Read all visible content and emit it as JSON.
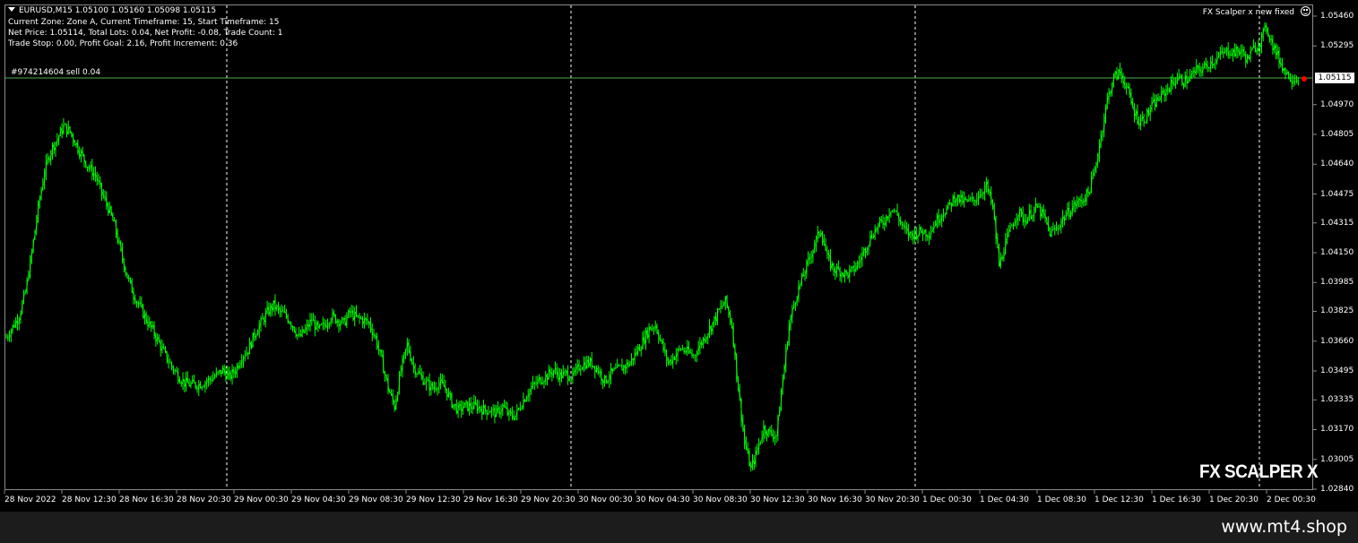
{
  "chart_header": {
    "symbol_line": "EURUSD,M15  1.05100 1.05160 1.05098 1.05115",
    "line2": "Current Zone: Zone A, Current Timeframe: 15, Start Timeframe: 15",
    "line3": "Net Price: 1.05114, Total Lots: 0.04, Net Profit: -0.08, Trade Count: 1",
    "line4": "Trade Stop: 0.00, Profit Goal: 2.16, Profit Increment: 0.36"
  },
  "expert": {
    "name": "FX Scalper x new fixed",
    "icon": "smiley-icon",
    "brand": "FX SCALPER X"
  },
  "order": {
    "label": "#974214604 sell 0.04",
    "price_tag": "1.05115",
    "line_color": "#4caf50"
  },
  "footer": {
    "site": "www.mt4.shop"
  },
  "colors": {
    "background": "#000000",
    "candles": "#00ff00",
    "grid_separator": "#ffffff",
    "text": "#ffffff"
  },
  "chart_data": {
    "type": "line",
    "symbol": "EURUSD",
    "timeframe": "M15",
    "ylim": [
      1.0284,
      1.0546
    ],
    "y_ticks": [
      "1.05460",
      "1.05295",
      "1.05115",
      "1.04970",
      "1.04805",
      "1.04640",
      "1.04475",
      "1.04315",
      "1.04150",
      "1.03985",
      "1.03825",
      "1.03660",
      "1.03495",
      "1.03335",
      "1.03170",
      "1.03005",
      "1.02840"
    ],
    "x_ticks": [
      "28 Nov 2022",
      "28 Nov 12:30",
      "28 Nov 16:30",
      "28 Nov 20:30",
      "29 Nov 00:30",
      "29 Nov 04:30",
      "29 Nov 08:30",
      "29 Nov 12:30",
      "29 Nov 16:30",
      "29 Nov 20:30",
      "30 Nov 00:30",
      "30 Nov 04:30",
      "30 Nov 08:30",
      "30 Nov 12:30",
      "30 Nov 16:30",
      "30 Nov 20:30",
      "1 Dec 00:30",
      "1 Dec 04:30",
      "1 Dec 08:30",
      "1 Dec 12:30",
      "1 Dec 16:30",
      "1 Dec 20:30",
      "2 Dec 00:30"
    ],
    "day_separators": [
      "29 Nov 00:00",
      "30 Nov 00:00",
      "1 Dec 00:00",
      "2 Dec 00:00"
    ],
    "current_price": 1.05115,
    "price_path": [
      [
        0,
        1.0368
      ],
      [
        2,
        1.038
      ],
      [
        3,
        1.0393
      ],
      [
        4,
        1.0415
      ],
      [
        5,
        1.044
      ],
      [
        6,
        1.046
      ],
      [
        7,
        1.0472
      ],
      [
        8,
        1.0478
      ],
      [
        9,
        1.0485
      ],
      [
        10,
        1.0482
      ],
      [
        11,
        1.0475
      ],
      [
        12,
        1.0468
      ],
      [
        13,
        1.0462
      ],
      [
        14,
        1.0458
      ],
      [
        15,
        1.0448
      ],
      [
        16,
        1.044
      ],
      [
        17,
        1.043
      ],
      [
        18,
        1.0415
      ],
      [
        19,
        1.0402
      ],
      [
        20,
        1.0392
      ],
      [
        21,
        1.0385
      ],
      [
        22,
        1.0378
      ],
      [
        23,
        1.0372
      ],
      [
        24,
        1.0365
      ],
      [
        25,
        1.0358
      ],
      [
        26,
        1.0352
      ],
      [
        27,
        1.0347
      ],
      [
        28,
        1.0343
      ],
      [
        29,
        1.0342
      ],
      [
        30,
        1.0342
      ],
      [
        31,
        1.0343
      ],
      [
        32,
        1.0345
      ],
      [
        33,
        1.0347
      ],
      [
        34,
        1.035
      ],
      [
        35,
        1.0346
      ],
      [
        36,
        1.035
      ],
      [
        37,
        1.0358
      ],
      [
        38,
        1.0361
      ],
      [
        39,
        1.037
      ],
      [
        40,
        1.0376
      ],
      [
        41,
        1.0382
      ],
      [
        42,
        1.0386
      ],
      [
        43,
        1.0382
      ],
      [
        44,
        1.038
      ],
      [
        45,
        1.0375
      ],
      [
        46,
        1.0368
      ],
      [
        47,
        1.0372
      ],
      [
        48,
        1.0378
      ],
      [
        49,
        1.0372
      ],
      [
        50,
        1.0375
      ],
      [
        51,
        1.038
      ],
      [
        52,
        1.0378
      ],
      [
        53,
        1.0376
      ],
      [
        54,
        1.0382
      ],
      [
        55,
        1.0379
      ],
      [
        56,
        1.0378
      ],
      [
        57,
        1.0376
      ],
      [
        58,
        1.0368
      ],
      [
        59,
        1.0355
      ],
      [
        60,
        1.034
      ],
      [
        61,
        1.033
      ],
      [
        62,
        1.035
      ],
      [
        63,
        1.0364
      ],
      [
        64,
        1.0352
      ],
      [
        65,
        1.0347
      ],
      [
        66,
        1.0343
      ],
      [
        67,
        1.034
      ],
      [
        68,
        1.0343
      ],
      [
        69,
        1.034
      ],
      [
        70,
        1.0332
      ],
      [
        71,
        1.0328
      ],
      [
        72,
        1.033
      ],
      [
        73,
        1.033
      ],
      [
        74,
        1.033
      ],
      [
        75,
        1.0328
      ],
      [
        76,
        1.0328
      ],
      [
        77,
        1.0326
      ],
      [
        78,
        1.033
      ],
      [
        79,
        1.0325
      ],
      [
        80,
        1.0325
      ],
      [
        81,
        1.0332
      ],
      [
        82,
        1.0338
      ],
      [
        83,
        1.0342
      ],
      [
        84,
        1.0345
      ],
      [
        85,
        1.0347
      ],
      [
        86,
        1.035
      ],
      [
        87,
        1.0347
      ],
      [
        88,
        1.0348
      ],
      [
        89,
        1.0346
      ],
      [
        90,
        1.0352
      ],
      [
        91,
        1.0354
      ],
      [
        92,
        1.0354
      ],
      [
        93,
        1.035
      ],
      [
        94,
        1.0344
      ],
      [
        95,
        1.0348
      ],
      [
        96,
        1.035
      ],
      [
        97,
        1.0352
      ],
      [
        98,
        1.0354
      ],
      [
        99,
        1.036
      ],
      [
        100,
        1.0366
      ],
      [
        101,
        1.0373
      ],
      [
        102,
        1.0375
      ],
      [
        103,
        1.0364
      ],
      [
        104,
        1.0354
      ],
      [
        105,
        1.0358
      ],
      [
        106,
        1.0362
      ],
      [
        107,
        1.036
      ],
      [
        108,
        1.0358
      ],
      [
        109,
        1.0364
      ],
      [
        110,
        1.037
      ],
      [
        111,
        1.0376
      ],
      [
        112,
        1.0383
      ],
      [
        113,
        1.0388
      ],
      [
        114,
        1.0375
      ],
      [
        115,
        1.034
      ],
      [
        116,
        1.031
      ],
      [
        117,
        1.0295
      ],
      [
        118,
        1.0306
      ],
      [
        119,
        1.0318
      ],
      [
        120,
        1.0315
      ],
      [
        121,
        1.0314
      ],
      [
        122,
        1.0345
      ],
      [
        123,
        1.0375
      ],
      [
        124,
        1.039
      ],
      [
        125,
        1.04
      ],
      [
        126,
        1.041
      ],
      [
        127,
        1.042
      ],
      [
        128,
        1.0428
      ],
      [
        129,
        1.0412
      ],
      [
        130,
        1.0406
      ],
      [
        131,
        1.0405
      ],
      [
        132,
        1.0403
      ],
      [
        133,
        1.0405
      ],
      [
        134,
        1.041
      ],
      [
        135,
        1.0418
      ],
      [
        136,
        1.0425
      ],
      [
        137,
        1.043
      ],
      [
        138,
        1.0433
      ],
      [
        139,
        1.044
      ],
      [
        140,
        1.0436
      ],
      [
        141,
        1.0428
      ],
      [
        142,
        1.0425
      ],
      [
        143,
        1.0426
      ],
      [
        144,
        1.0427
      ],
      [
        145,
        1.0426
      ],
      [
        146,
        1.0432
      ],
      [
        147,
        1.0437
      ],
      [
        148,
        1.044
      ],
      [
        149,
        1.0446
      ],
      [
        150,
        1.0444
      ],
      [
        151,
        1.0443
      ],
      [
        152,
        1.0444
      ],
      [
        153,
        1.0448
      ],
      [
        154,
        1.0452
      ],
      [
        155,
        1.044
      ],
      [
        156,
        1.0408
      ],
      [
        157,
        1.042
      ],
      [
        158,
        1.043
      ],
      [
        159,
        1.0438
      ],
      [
        160,
        1.0433
      ],
      [
        161,
        1.0437
      ],
      [
        162,
        1.044
      ],
      [
        163,
        1.0435
      ],
      [
        164,
        1.0426
      ],
      [
        165,
        1.0428
      ],
      [
        166,
        1.0434
      ],
      [
        167,
        1.0438
      ],
      [
        168,
        1.0442
      ],
      [
        169,
        1.0444
      ],
      [
        170,
        1.0448
      ],
      [
        171,
        1.046
      ],
      [
        172,
        1.048
      ],
      [
        173,
        1.05
      ],
      [
        174,
        1.0512
      ],
      [
        175,
        1.0515
      ],
      [
        176,
        1.0507
      ],
      [
        177,
        1.0495
      ],
      [
        178,
        1.0488
      ],
      [
        179,
        1.049
      ],
      [
        180,
        1.0496
      ],
      [
        181,
        1.05
      ],
      [
        182,
        1.0504
      ],
      [
        183,
        1.0508
      ],
      [
        184,
        1.0512
      ],
      [
        185,
        1.051
      ],
      [
        186,
        1.0512
      ],
      [
        187,
        1.0516
      ],
      [
        188,
        1.0517
      ],
      [
        189,
        1.052
      ],
      [
        190,
        1.0522
      ],
      [
        191,
        1.0525
      ],
      [
        192,
        1.0527
      ],
      [
        193,
        1.0526
      ],
      [
        194,
        1.0527
      ],
      [
        195,
        1.0522
      ],
      [
        196,
        1.0528
      ],
      [
        197,
        1.0532
      ],
      [
        198,
        1.054
      ],
      [
        199,
        1.053
      ],
      [
        200,
        1.0522
      ],
      [
        201,
        1.0515
      ],
      [
        202,
        1.0512
      ],
      [
        203,
        1.05115
      ]
    ]
  }
}
